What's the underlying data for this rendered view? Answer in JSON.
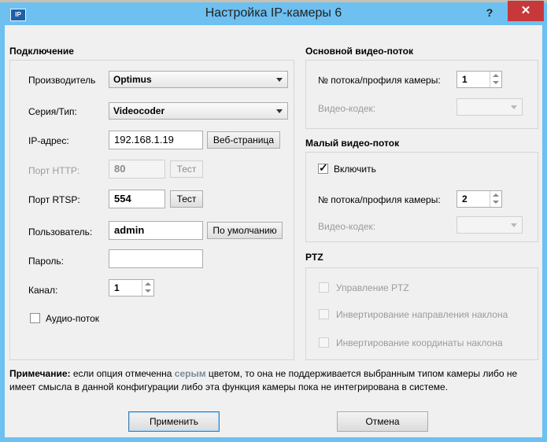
{
  "window": {
    "title": "Настройка IP-камеры 6",
    "icon_label": "IP",
    "help_symbol": "?",
    "close_symbol": "✕"
  },
  "connection": {
    "title": "Подключение",
    "manufacturer_label": "Производитель",
    "manufacturer_value": "Optimus",
    "series_label": "Серия/Тип:",
    "series_value": "Videocoder",
    "ip_label": "IP-адрес:",
    "ip_value": "192.168.1.19",
    "web_button": "Веб-страница",
    "http_label": "Порт HTTP:",
    "http_value": "80",
    "http_test_button": "Тест",
    "rtsp_label": "Порт RTSP:",
    "rtsp_value": "554",
    "rtsp_test_button": "Тест",
    "user_label": "Пользователь:",
    "user_value": "admin",
    "default_button": "По умолчанию",
    "password_label": "Пароль:",
    "password_value": "",
    "channel_label": "Канал:",
    "channel_value": "1",
    "audio_label": "Аудио-поток",
    "audio_checked": false
  },
  "main_stream": {
    "title": "Основной видео-поток",
    "profile_label": "№ потока/профиля камеры:",
    "profile_value": "1",
    "codec_label": "Видео-кодек:",
    "codec_value": ""
  },
  "sub_stream": {
    "title": "Малый видео-поток",
    "enable_label": "Включить",
    "enabled": true,
    "profile_label": "№ потока/профиля камеры:",
    "profile_value": "2",
    "codec_label": "Видео-кодек:",
    "codec_value": ""
  },
  "ptz": {
    "title": "PTZ",
    "control_label": "Управление PTZ",
    "invert_direction_label": "Инвертирование направления наклона",
    "invert_coords_label": "Инвертирование координаты наклона"
  },
  "note": {
    "bold_prefix": "Примечание:",
    "text_before": " если опция отмеченна ",
    "gray_word": "серым",
    "text_after": " цветом, то она не поддерживается выбранным типом камеры либо не имеет смысла в данной конфигурации либо эта функция камеры пока не интегрирована в системе."
  },
  "footer": {
    "apply_button": "Применить",
    "cancel_button": "Отмена"
  },
  "colors": {
    "titlebar": "#6dc0f0",
    "close": "#c7383b",
    "client_bg": "#f0f0f0",
    "disabled_text": "#9b9b9b"
  }
}
